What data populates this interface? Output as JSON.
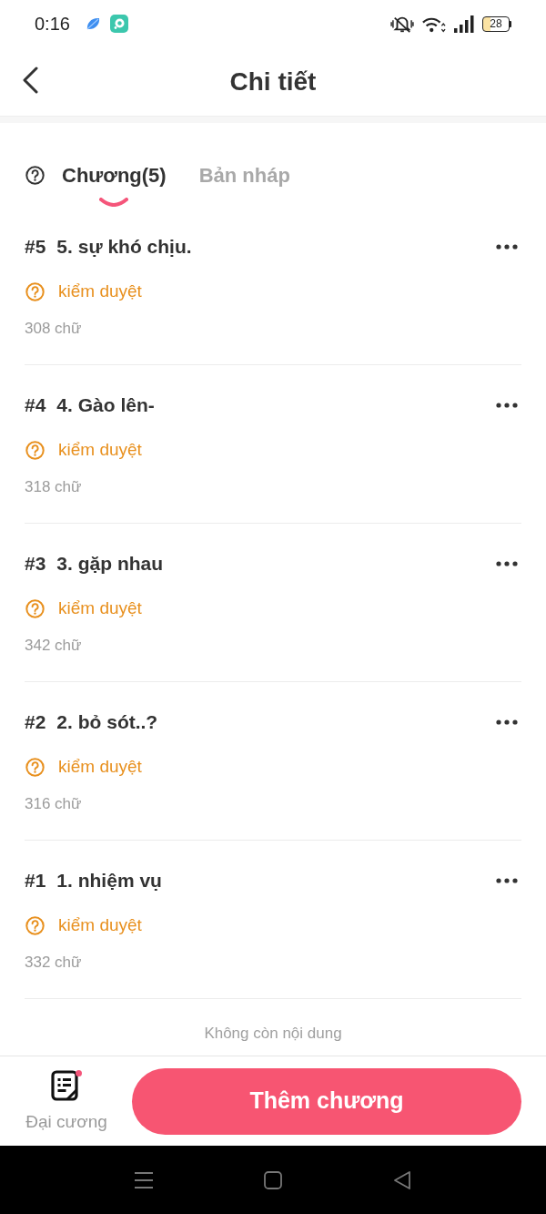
{
  "status_bar": {
    "time": "0:16",
    "battery": "28"
  },
  "header": {
    "title": "Chi tiết"
  },
  "tabs": [
    {
      "label": "Chương(5)",
      "selected": true
    },
    {
      "label": "Bản nháp",
      "selected": false
    }
  ],
  "chapters": [
    {
      "number": "#5",
      "title": "5. sự khó chịu.",
      "status": "kiểm duyệt",
      "word_count": "308 chữ"
    },
    {
      "number": "#4",
      "title": "4. Gào lên-",
      "status": "kiểm duyệt",
      "word_count": "318 chữ"
    },
    {
      "number": "#3",
      "title": "3. gặp nhau",
      "status": "kiểm duyệt",
      "word_count": "342 chữ"
    },
    {
      "number": "#2",
      "title": "2. bỏ sót..?",
      "status": "kiểm duyệt",
      "word_count": "316 chữ"
    },
    {
      "number": "#1",
      "title": "1. nhiệm vụ",
      "status": "kiểm duyệt",
      "word_count": "332 chữ"
    }
  ],
  "end_note": "Không còn nội dung",
  "footer": {
    "outline_label": "Đại cương",
    "has_notification": true,
    "add_button": "Thêm chương"
  }
}
